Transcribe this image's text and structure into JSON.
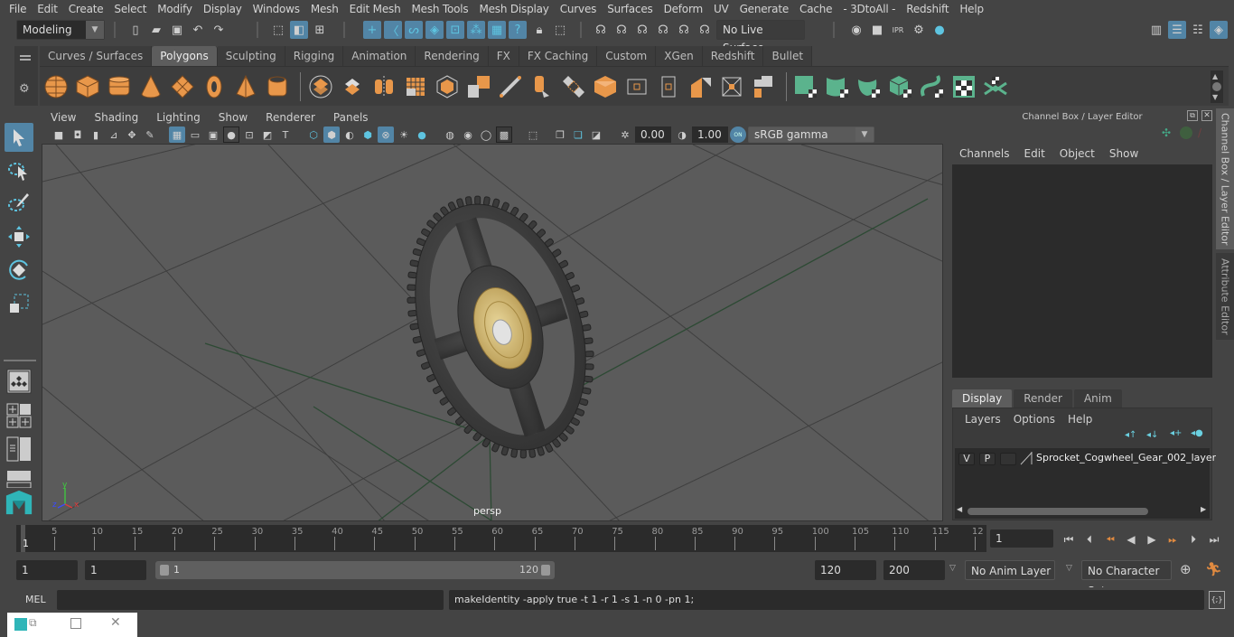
{
  "menubar": {
    "items": [
      "File",
      "Edit",
      "Create",
      "Select",
      "Modify",
      "Display",
      "Windows",
      "Mesh",
      "Edit Mesh",
      "Mesh Tools",
      "Mesh Display",
      "Curves",
      "Surfaces",
      "Deform",
      "UV",
      "Generate",
      "Cache",
      "- 3DtoAll -",
      "Redshift",
      "Help"
    ]
  },
  "statusline": {
    "mode_dropdown": "Modeling",
    "live_surface": "No Live Surface"
  },
  "shelf": {
    "tabs": [
      "Curves / Surfaces",
      "Polygons",
      "Sculpting",
      "Rigging",
      "Animation",
      "Rendering",
      "FX",
      "FX Caching",
      "Custom",
      "XGen",
      "Redshift",
      "Bullet"
    ],
    "active_tab": "Polygons",
    "colors": {
      "orange": "#e8974a",
      "green": "#5bb38d",
      "accent": "#5285a6"
    }
  },
  "panel": {
    "menus": [
      "View",
      "Shading",
      "Lighting",
      "Show",
      "Renderer",
      "Panels"
    ],
    "exposure": "0.00",
    "gamma": "1.00",
    "color_management": "sRGB gamma",
    "camera_label": "persp",
    "axis": {
      "x": "x",
      "y": "y",
      "z": "z"
    }
  },
  "right_panel": {
    "title": "Channel Box / Layer Editor",
    "channel_menus": [
      "Channels",
      "Edit",
      "Object",
      "Show"
    ],
    "layer_tabs": [
      "Display",
      "Render",
      "Anim"
    ],
    "active_layer_tab": "Display",
    "layer_menus": [
      "Layers",
      "Options",
      "Help"
    ],
    "layers": [
      {
        "visible": "V",
        "playback": "P",
        "name": "Sprocket_Cogwheel_Gear_002_layer"
      }
    ],
    "side_tabs": [
      "Channel Box / Layer Editor",
      "Attribute Editor"
    ]
  },
  "timeline": {
    "start_label": "1",
    "ticks": [
      "5",
      "10",
      "15",
      "20",
      "25",
      "30",
      "35",
      "40",
      "45",
      "50",
      "55",
      "60",
      "65",
      "70",
      "75",
      "80",
      "85",
      "90",
      "95",
      "100",
      "105",
      "110",
      "115",
      "12"
    ],
    "current_frame": "1"
  },
  "range": {
    "start": "1",
    "playback_start": "1",
    "slider_start": "1",
    "slider_end": "120",
    "playback_end": "120",
    "end": "200",
    "anim_layer": "No Anim Layer",
    "character_set": "No Character Set"
  },
  "command": {
    "language": "MEL",
    "input": "",
    "result": "makeIdentity -apply true -t 1 -r 1 -s 1 -n 0 -pn 1;"
  }
}
